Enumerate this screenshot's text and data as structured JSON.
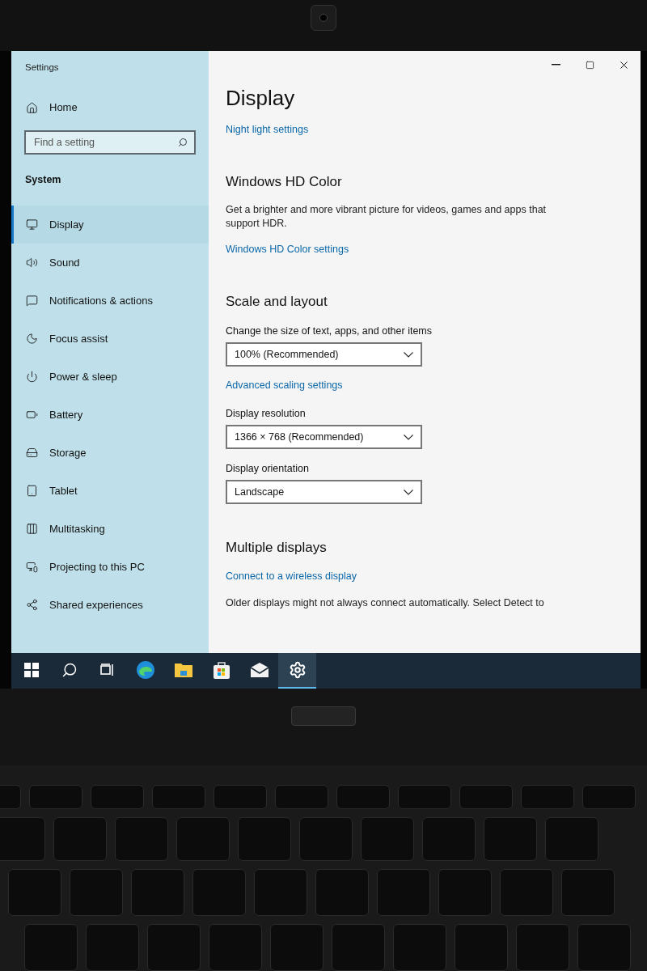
{
  "window": {
    "title": "Settings"
  },
  "sidebar": {
    "home": "Home",
    "search": {
      "placeholder": "Find a setting"
    },
    "section": "System",
    "items": [
      {
        "label": "Display",
        "selected": true
      },
      {
        "label": "Sound",
        "selected": false
      },
      {
        "label": "Notifications & actions",
        "selected": false
      },
      {
        "label": "Focus assist",
        "selected": false
      },
      {
        "label": "Power & sleep",
        "selected": false
      },
      {
        "label": "Battery",
        "selected": false
      },
      {
        "label": "Storage",
        "selected": false
      },
      {
        "label": "Tablet",
        "selected": false
      },
      {
        "label": "Multitasking",
        "selected": false
      },
      {
        "label": "Projecting to this PC",
        "selected": false
      },
      {
        "label": "Shared experiences",
        "selected": false
      }
    ]
  },
  "content": [
    {
      "kind": "title",
      "text": "Display"
    },
    {
      "kind": "link",
      "text": "Night light settings"
    },
    {
      "kind": "heading",
      "text": "Windows HD Color"
    },
    {
      "kind": "paragraph",
      "text": "Get a brighter and more vibrant picture for videos, games and apps that support HDR."
    },
    {
      "kind": "link",
      "text": "Windows HD Color settings"
    },
    {
      "kind": "heading",
      "text": "Scale and layout"
    },
    {
      "kind": "label",
      "text": "Change the size of text, apps, and other items"
    },
    {
      "kind": "dropdown",
      "text": "100% (Recommended)"
    },
    {
      "kind": "link",
      "text": "Advanced scaling settings"
    },
    {
      "kind": "label",
      "text": "Display resolution"
    },
    {
      "kind": "dropdown",
      "text": "1366 × 768 (Recommended)"
    },
    {
      "kind": "label",
      "text": "Display orientation"
    },
    {
      "kind": "dropdown",
      "text": "Landscape"
    },
    {
      "kind": "heading",
      "text": "Multiple displays"
    },
    {
      "kind": "link",
      "text": "Connect to a wireless display"
    },
    {
      "kind": "paragraph",
      "text": "Older displays might not always connect automatically. Select Detect to"
    }
  ],
  "taskbar": [
    {
      "kind": "start",
      "selected": false
    },
    {
      "kind": "search",
      "selected": false
    },
    {
      "kind": "taskview",
      "selected": false
    },
    {
      "kind": "browser",
      "selected": false
    },
    {
      "kind": "folder",
      "selected": false
    },
    {
      "kind": "store",
      "selected": false
    },
    {
      "kind": "mail",
      "selected": false
    },
    {
      "kind": "settings",
      "selected": true
    }
  ]
}
